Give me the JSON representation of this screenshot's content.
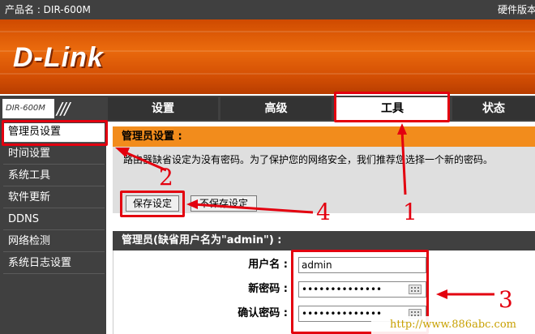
{
  "topbar": {
    "product_label": "产品名 : DIR-600M",
    "hardware_label": "硬件版本"
  },
  "brand": {
    "logo": "D-Link",
    "model": "DIR-600M"
  },
  "nav": {
    "tabs": [
      {
        "label": "设置"
      },
      {
        "label": "高级"
      },
      {
        "label": "工具"
      },
      {
        "label": "状态"
      }
    ],
    "active": "工具"
  },
  "sidebar": {
    "items": [
      {
        "label": "管理员设置"
      },
      {
        "label": "时间设置"
      },
      {
        "label": "系统工具"
      },
      {
        "label": "软件更新"
      },
      {
        "label": "DDNS"
      },
      {
        "label": "网络检测"
      },
      {
        "label": "系统日志设置"
      }
    ],
    "active": "管理员设置"
  },
  "admin_settings": {
    "title": "管理员设置 :",
    "description": "路由器缺省设定为没有密码。为了保护您的网络安全，我们推荐您选择一个新的密码。",
    "save_label": "保存设定",
    "cancel_label": "不保存设定"
  },
  "admin_account": {
    "title": "管理员(缺省用户名为\"admin\") :",
    "username_label": "用户名 :",
    "username_value": "admin",
    "password_label": "新密码 :",
    "password_value": "••••••••••••••",
    "confirm_label": "确认密码 :",
    "confirm_value": "••••••••••••••"
  },
  "annotations": {
    "step1": "1",
    "step2": "2",
    "step3": "3",
    "step4": "4",
    "color": "#e3000f"
  },
  "watermark": "http://www.886abc.com"
}
